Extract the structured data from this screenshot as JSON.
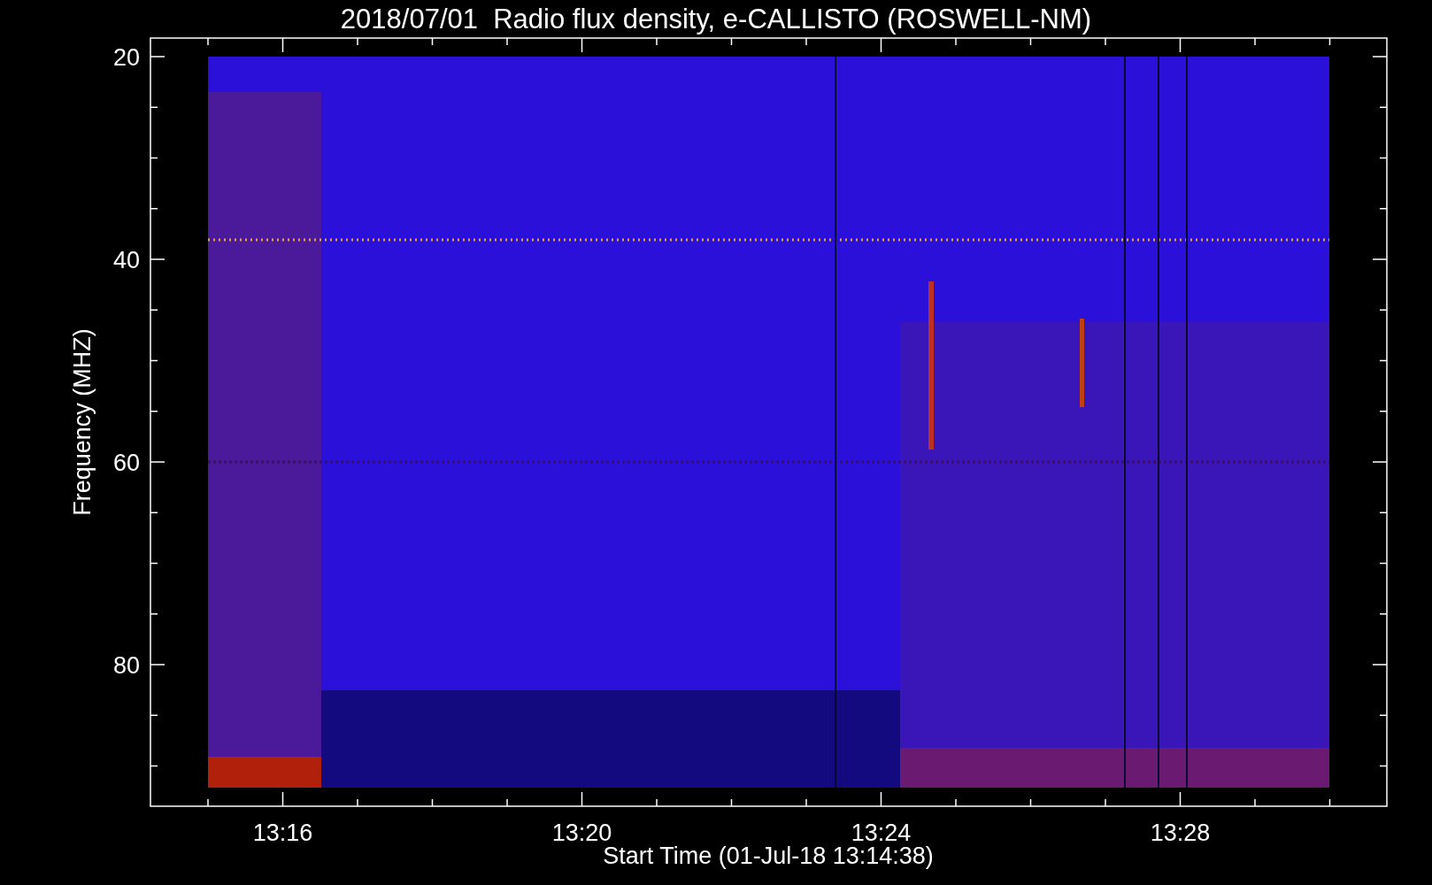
{
  "title": "2018/07/01  Radio flux density, e-CALLISTO (ROSWELL-NM)",
  "y_axis": {
    "label": "Frequency (MHZ)",
    "ticks": [
      "20",
      "40",
      "60",
      "80"
    ]
  },
  "x_axis": {
    "label": "Start Time (01-Jul-18 13:14:38)",
    "ticks": [
      "13:16",
      "13:20",
      "13:24",
      "13:28"
    ]
  }
}
